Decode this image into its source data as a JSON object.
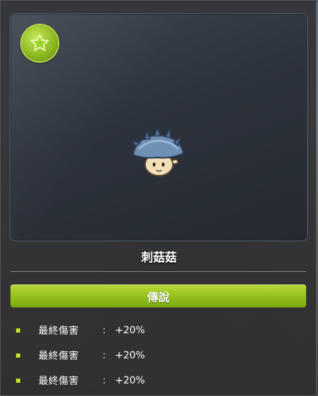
{
  "item": {
    "name": "刺菇菇",
    "rank": "傳說",
    "badge_icon": "star-icon",
    "sprite": "spiky-mushroom-icon",
    "stats": [
      {
        "label": "最終傷害",
        "separator": ":",
        "value": "+20%"
      },
      {
        "label": "最終傷害",
        "separator": ":",
        "value": "+20%"
      },
      {
        "label": "最終傷害",
        "separator": ":",
        "value": "+20%"
      }
    ]
  },
  "colors": {
    "rank_green": "#95c11a",
    "bullet": "#c4e22a"
  }
}
